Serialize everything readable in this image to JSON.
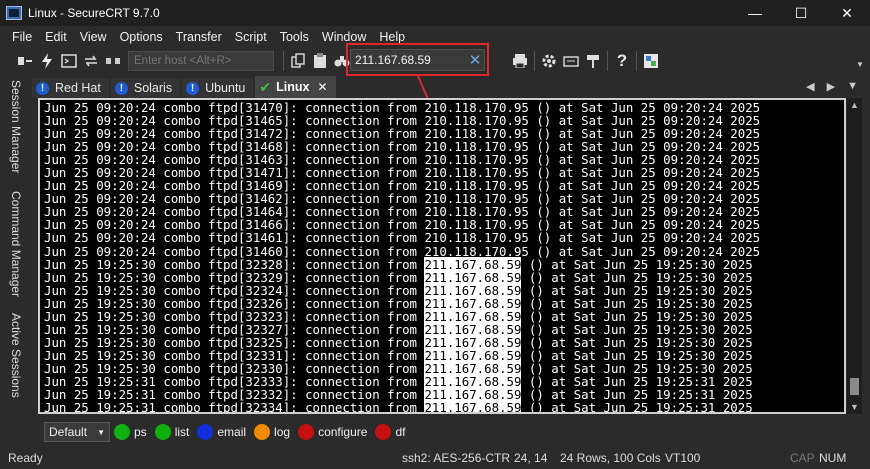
{
  "window": {
    "title": "Linux - SecureCRT 9.7.0",
    "min": "—",
    "max": "☐",
    "close": "✕"
  },
  "menu": [
    "File",
    "Edit",
    "View",
    "Options",
    "Transfer",
    "Script",
    "Tools",
    "Window",
    "Help"
  ],
  "toolbar": {
    "host_placeholder": "Enter host <Alt+R>",
    "find_value": "211.167.68.59",
    "find_clear": "✕"
  },
  "side_tabs": [
    "Session Manager",
    "Command Manager",
    "Active Sessions"
  ],
  "tabs": [
    {
      "label": "Red Hat",
      "icon": "warning-icon",
      "active": false
    },
    {
      "label": "Solaris",
      "icon": "warning-icon",
      "active": false
    },
    {
      "label": "Ubuntu",
      "icon": "warning-icon",
      "active": false
    },
    {
      "label": "Linux",
      "icon": "check-icon",
      "active": true
    }
  ],
  "tab_close": "✕",
  "tab_nav": {
    "left": "◀",
    "right": "▶",
    "menu": "▼"
  },
  "terminal": {
    "highlight": "211.167.68.59",
    "lines": [
      "Jun 25 09:20:24 combo ftpd[31470]: connection from 210.118.170.95 () at Sat Jun 25 09:20:24 2025",
      "Jun 25 09:20:24 combo ftpd[31465]: connection from 210.118.170.95 () at Sat Jun 25 09:20:24 2025",
      "Jun 25 09:20:24 combo ftpd[31472]: connection from 210.118.170.95 () at Sat Jun 25 09:20:24 2025",
      "Jun 25 09:20:24 combo ftpd[31468]: connection from 210.118.170.95 () at Sat Jun 25 09:20:24 2025",
      "Jun 25 09:20:24 combo ftpd[31463]: connection from 210.118.170.95 () at Sat Jun 25 09:20:24 2025",
      "Jun 25 09:20:24 combo ftpd[31471]: connection from 210.118.170.95 () at Sat Jun 25 09:20:24 2025",
      "Jun 25 09:20:24 combo ftpd[31469]: connection from 210.118.170.95 () at Sat Jun 25 09:20:24 2025",
      "Jun 25 09:20:24 combo ftpd[31462]: connection from 210.118.170.95 () at Sat Jun 25 09:20:24 2025",
      "Jun 25 09:20:24 combo ftpd[31464]: connection from 210.118.170.95 () at Sat Jun 25 09:20:24 2025",
      "Jun 25 09:20:24 combo ftpd[31466]: connection from 210.118.170.95 () at Sat Jun 25 09:20:24 2025",
      "Jun 25 09:20:24 combo ftpd[31461]: connection from 210.118.170.95 () at Sat Jun 25 09:20:24 2025",
      "Jun 25 09:20:24 combo ftpd[31460]: connection from 210.118.170.95 () at Sat Jun 25 09:20:24 2025",
      "Jun 25 19:25:30 combo ftpd[32328]: connection from 211.167.68.59 () at Sat Jun 25 19:25:30 2025",
      "Jun 25 19:25:30 combo ftpd[32329]: connection from 211.167.68.59 () at Sat Jun 25 19:25:30 2025",
      "Jun 25 19:25:30 combo ftpd[32324]: connection from 211.167.68.59 () at Sat Jun 25 19:25:30 2025",
      "Jun 25 19:25:30 combo ftpd[32326]: connection from 211.167.68.59 () at Sat Jun 25 19:25:30 2025",
      "Jun 25 19:25:30 combo ftpd[32323]: connection from 211.167.68.59 () at Sat Jun 25 19:25:30 2025",
      "Jun 25 19:25:30 combo ftpd[32327]: connection from 211.167.68.59 () at Sat Jun 25 19:25:30 2025",
      "Jun 25 19:25:30 combo ftpd[32325]: connection from 211.167.68.59 () at Sat Jun 25 19:25:30 2025",
      "Jun 25 19:25:30 combo ftpd[32331]: connection from 211.167.68.59 () at Sat Jun 25 19:25:30 2025",
      "Jun 25 19:25:30 combo ftpd[32330]: connection from 211.167.68.59 () at Sat Jun 25 19:25:30 2025",
      "Jun 25 19:25:31 combo ftpd[32333]: connection from 211.167.68.59 () at Sat Jun 25 19:25:31 2025",
      "Jun 25 19:25:31 combo ftpd[32332]: connection from 211.167.68.59 () at Sat Jun 25 19:25:31 2025",
      "Jun 25 19:25:31 combo ftpd[32334]: connection from 211.167.68.59 () at Sat Jun 25 19:25:31 2025"
    ]
  },
  "button_bar": {
    "selector": "Default",
    "buttons": [
      {
        "label": "ps",
        "color": "#10b010"
      },
      {
        "label": "list",
        "color": "#10b010"
      },
      {
        "label": "email",
        "color": "#1030e0"
      },
      {
        "label": "log",
        "color": "#f08a00"
      },
      {
        "label": "configure",
        "color": "#c81010"
      },
      {
        "label": "df",
        "color": "#c81010"
      }
    ]
  },
  "status": {
    "ready": "Ready",
    "cipher": "ssh2: AES-256-CTR",
    "cursor": "24, 14",
    "size": "24 Rows, 100 Cols",
    "terminal_type": "VT100",
    "cap": "CAP",
    "num": "NUM"
  },
  "colors": {
    "highlight_border": "#e0262a",
    "terminal_bg": "#000000",
    "terminal_fg": "#ffffff"
  }
}
